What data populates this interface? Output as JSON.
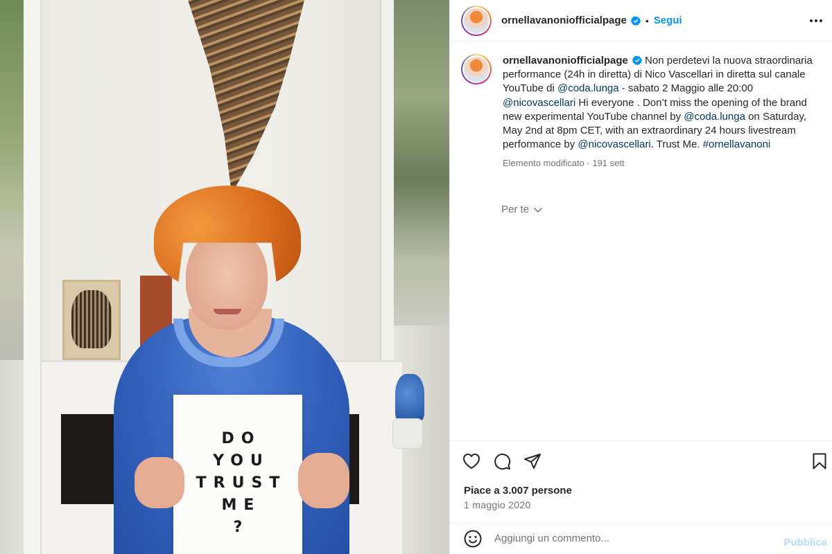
{
  "colors": {
    "link": "#00376b",
    "follow": "#0095f6",
    "muted": "#737373",
    "text": "#262626",
    "publish_disabled": "#b2dffc"
  },
  "photo": {
    "sign_lines": [
      "DO",
      "YOU",
      "TRUST",
      "ME",
      "?"
    ]
  },
  "header": {
    "username": "ornellavanoniofficialpage",
    "separator": "•",
    "follow_label": "Segui",
    "more_icon": "more-horizontal-icon"
  },
  "caption": {
    "username": "ornellavanoniofficialpage",
    "parts": [
      {
        "t": "Non perdetevi la nuova straordinaria performance (24h in diretta) di Nico Vascellari in diretta sul canale YouTube di ",
        "m": false
      },
      {
        "t": "@coda.lunga",
        "m": true
      },
      {
        "t": " - sabato 2 Maggio alle 20:00 ",
        "m": false
      },
      {
        "t": "@nicovascellari",
        "m": true
      },
      {
        "t": " Hi everyone . Don’t miss the opening of the brand new experimental YouTube channel by ",
        "m": false
      },
      {
        "t": "@coda.lunga",
        "m": true
      },
      {
        "t": " on Saturday, May 2nd at 8pm CET, with an extraordinary 24 hours livestream performance by ",
        "m": false
      },
      {
        "t": "@nicovascellari",
        "m": true
      },
      {
        "t": ". Trust Me. ",
        "m": false
      },
      {
        "t": "#ornellavanoni",
        "m": true
      }
    ],
    "meta": "Elemento modificato · 191 sett"
  },
  "for_you": {
    "label": "Per te"
  },
  "actions": {
    "icons": [
      "heart-icon",
      "comment-icon",
      "share-icon",
      "bookmark-icon"
    ]
  },
  "likes": "Piace a 3.007 persone",
  "date": "1 maggio 2020",
  "comment": {
    "placeholder": "Aggiungi un commento...",
    "publish_label": "Pubblica"
  }
}
